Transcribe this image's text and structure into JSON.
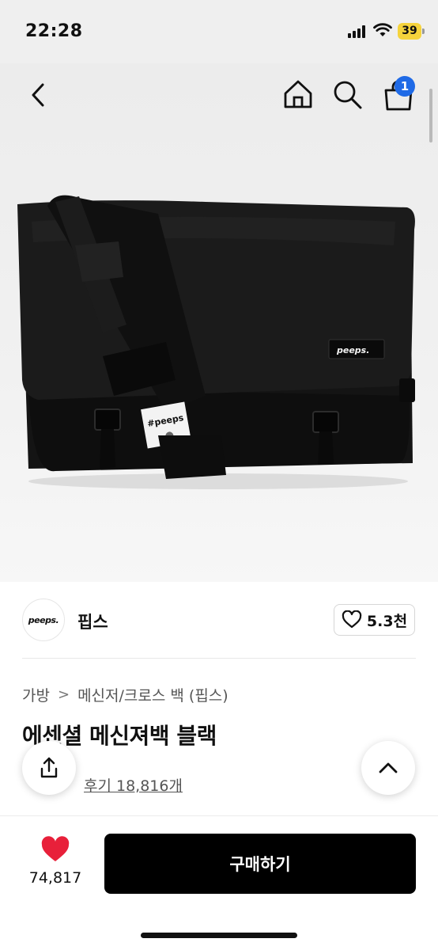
{
  "status_bar": {
    "time": "22:28",
    "battery": "39"
  },
  "nav": {
    "back_icon": "chevron-left-icon",
    "home_icon": "home-icon",
    "search_icon": "search-icon",
    "cart_icon": "shopping-bag-icon",
    "cart_badge": "1"
  },
  "hero_image": {
    "subject": "black messenger bag",
    "bag_label": "peeps.",
    "strap_patch": "#peeps"
  },
  "brand": {
    "logo_text": "peeps.",
    "name": "핍스",
    "like_icon": "heart-outline-icon",
    "like_count": "5.3천"
  },
  "breadcrumb": {
    "items": [
      "가방",
      "메신저/크로스 백 (핍스)"
    ],
    "separator": ">"
  },
  "product": {
    "title": "에센셜 메신져백 블랙",
    "review_text": "후기 18,816개"
  },
  "floating": {
    "share_icon": "share-icon",
    "top_icon": "chevron-up-icon"
  },
  "bottom_bar": {
    "wish_icon": "heart-filled-icon",
    "wish_count": "74,817",
    "buy_label": "구매하기"
  },
  "colors": {
    "accent_blue": "#1f6ae6",
    "heart_red": "#e8203a",
    "buy_button": "#000000",
    "battery": "#f5d33c"
  }
}
